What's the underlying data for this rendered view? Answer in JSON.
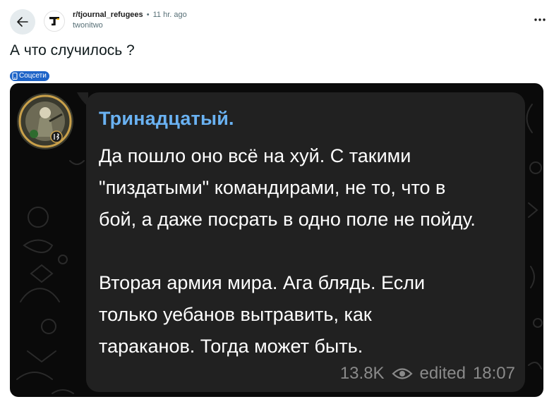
{
  "header": {
    "subreddit": "r/tjournal_refugees",
    "separator": "•",
    "time": "11 hr. ago",
    "username": "twonitwo"
  },
  "post": {
    "title": "А что случилось ?",
    "flair": "Соцсети"
  },
  "telegram_message": {
    "sender": "Тринадцатый.",
    "paragraph1_lines": [
      "Да пошло оно всё на хуй. С такими",
      "\"пиздатыми\" командирами, не то, что в",
      "бой, а даже посрать в одно поле не пойду."
    ],
    "paragraph2_lines": [
      "Вторая армия мира. Ага блядь. Если",
      "только уебанов вытравить, как",
      "тараканов. Тогда может быть."
    ],
    "views": "13.8K",
    "edited": "edited",
    "time": "18:07"
  },
  "colors": {
    "flair_bg": "#1e64c8",
    "sender_name": "#6ab2f2",
    "bubble_bg": "#212121",
    "image_bg": "#0a0a0a"
  },
  "icons": {
    "back": "arrow-left-icon",
    "subreddit": "tjournal-logo-icon",
    "more": "more-options-icon",
    "flair": "phone-icon",
    "views": "eye-icon"
  }
}
